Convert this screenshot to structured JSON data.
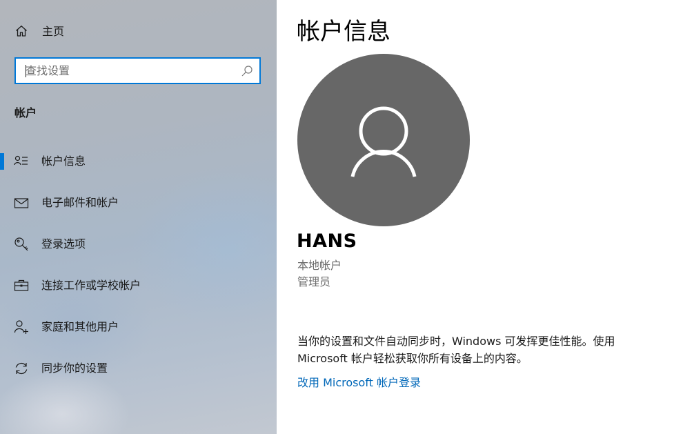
{
  "sidebar": {
    "home_label": "主页",
    "search": {
      "placeholder": "查找设置",
      "value": ""
    },
    "section_title": "帐户",
    "items": [
      {
        "label": "帐户信息",
        "icon": "account-info-icon",
        "selected": true
      },
      {
        "label": "电子邮件和帐户",
        "icon": "mail-icon",
        "selected": false
      },
      {
        "label": "登录选项",
        "icon": "key-icon",
        "selected": false
      },
      {
        "label": "连接工作或学校帐户",
        "icon": "briefcase-icon",
        "selected": false
      },
      {
        "label": "家庭和其他用户",
        "icon": "add-person-icon",
        "selected": false
      },
      {
        "label": "同步你的设置",
        "icon": "sync-icon",
        "selected": false
      }
    ]
  },
  "main": {
    "title": "帐户信息",
    "user": {
      "name": "HANS",
      "account_type": "本地帐户",
      "role": "管理员"
    },
    "sync_info": "当你的设置和文件自动同步时，Windows 可发挥更佳性能。使用 Microsoft 帐户轻松获取你所有设备上的内容。",
    "link_label": "改用 Microsoft 帐户登录"
  },
  "colors": {
    "accent": "#0078d7",
    "link": "#0067b8",
    "avatar_bg": "#676767",
    "secondary_text": "#6b6b6b"
  }
}
